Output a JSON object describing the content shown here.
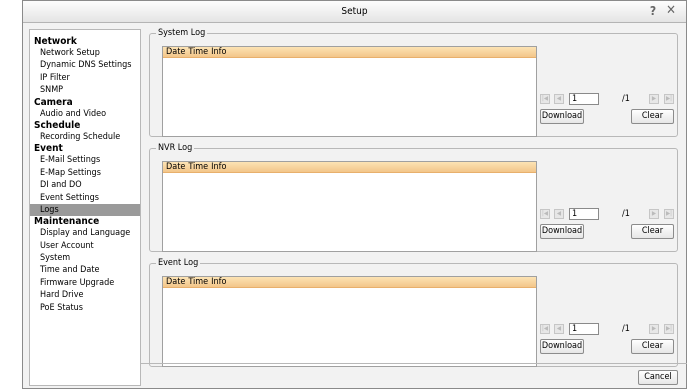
{
  "window": {
    "title": "Setup"
  },
  "sidebar": {
    "groups": [
      {
        "label": "Network",
        "items": [
          "Network Setup",
          "Dynamic DNS Settings",
          "IP Filter",
          "SNMP"
        ]
      },
      {
        "label": "Camera",
        "items": [
          "Audio and Video"
        ]
      },
      {
        "label": "Schedule",
        "items": [
          "Recording Schedule"
        ]
      },
      {
        "label": "Event",
        "items": [
          "E-Mail Settings",
          "E-Map Settings",
          "DI and DO",
          "Event Settings",
          "Logs"
        ]
      },
      {
        "label": "Maintenance",
        "items": [
          "Display and Language",
          "User Account",
          "System",
          "Time and Date",
          "Firmware Upgrade",
          "Hard Drive",
          "PoE Status"
        ]
      }
    ],
    "active_item": "Logs"
  },
  "logs": [
    {
      "title": "System Log",
      "columns": [
        "Date",
        "Time",
        "Info"
      ],
      "page": "1",
      "total": "/1",
      "download_label": "Download",
      "clear_label": "Clear"
    },
    {
      "title": "NVR Log",
      "columns": [
        "Date",
        "Time",
        "Info"
      ],
      "page": "1",
      "total": "/1",
      "download_label": "Download",
      "clear_label": "Clear"
    },
    {
      "title": "Event Log",
      "columns": [
        "Date",
        "Time",
        "Info"
      ],
      "page": "1",
      "total": "/1",
      "download_label": "Download",
      "clear_label": "Clear"
    }
  ],
  "footer": {
    "cancel_label": "Cancel"
  },
  "colors": {
    "active_bg": "#9a9a9a",
    "header_bg": "#f3c58a"
  }
}
